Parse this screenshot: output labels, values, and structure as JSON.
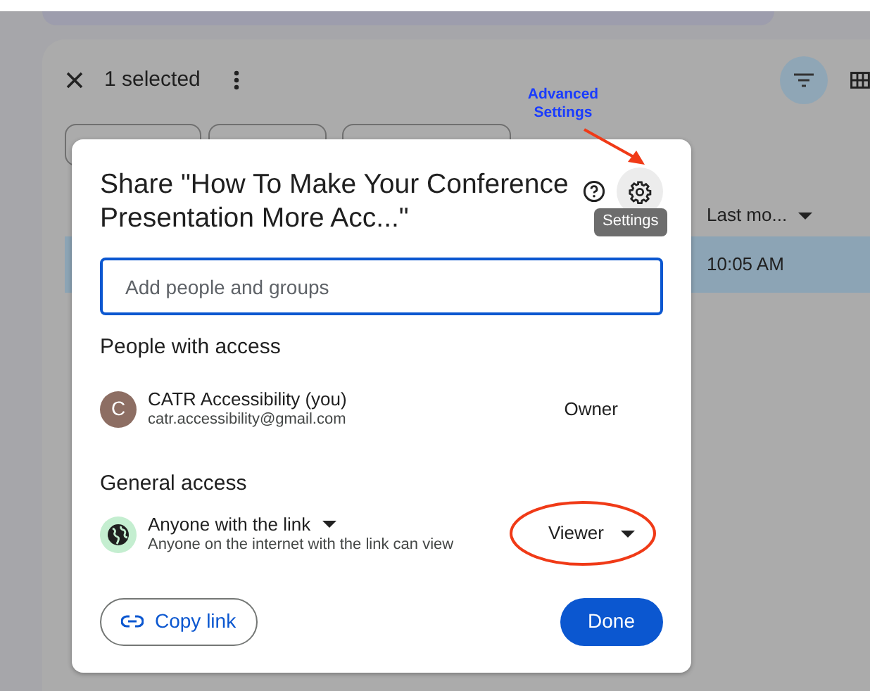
{
  "toolbar": {
    "selection_count": "1 selected"
  },
  "file_list": {
    "columns": [
      {
        "label": "Last mo..."
      }
    ],
    "rows": [
      {
        "cells": [
          "10:05 AM"
        ],
        "selected": true
      }
    ]
  },
  "dialog": {
    "title": "Share \"How To Make Your Conference Presentation More Acc...\"",
    "tooltip": "Settings",
    "search": {
      "placeholder": "Add people and groups"
    },
    "people_heading": "People with access",
    "people": [
      {
        "initial": "C",
        "name": "CATR Accessibility (you)",
        "email": "catr.accessibility@gmail.com",
        "role": "Owner"
      }
    ],
    "general_heading": "General access",
    "access": {
      "scope": "Anyone with the link",
      "description": "Anyone on the internet with the link can view",
      "role": "Viewer"
    },
    "buttons": [
      {
        "label": "Copy link",
        "kind": "outline"
      },
      {
        "label": "Done",
        "kind": "primary"
      }
    ]
  },
  "annotations": [
    {
      "kind": "label",
      "text": "Advanced Settings"
    },
    {
      "kind": "arrow"
    },
    {
      "kind": "ellipse"
    }
  ]
}
